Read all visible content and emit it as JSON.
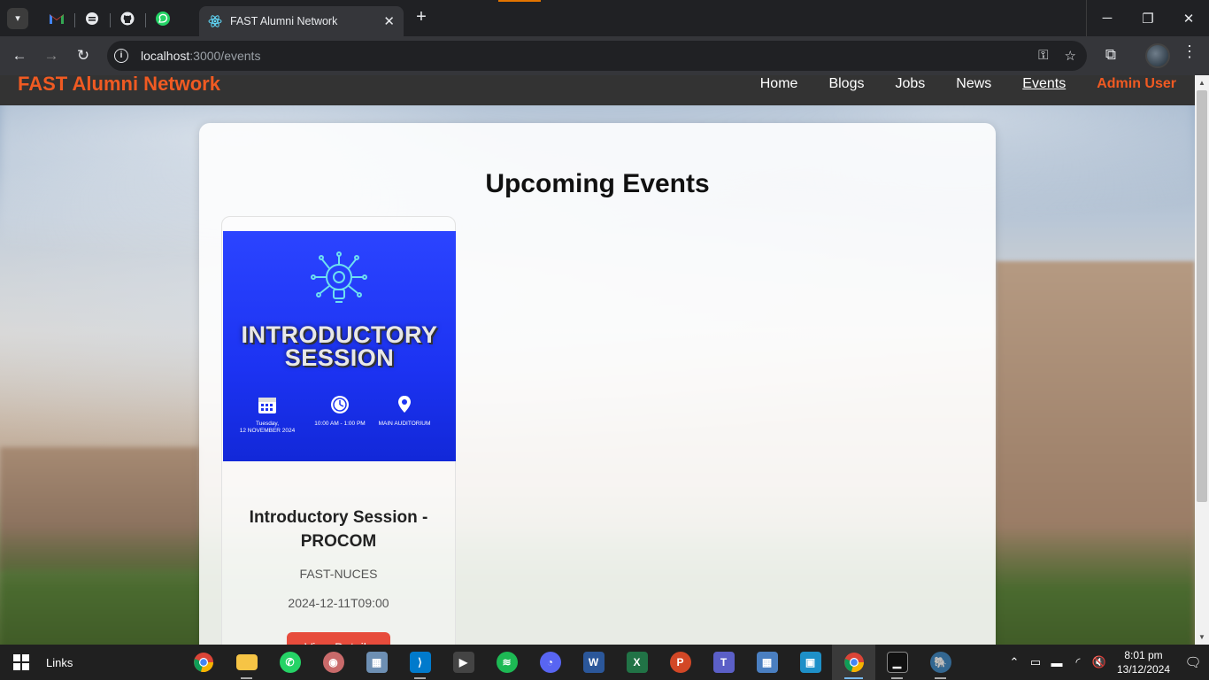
{
  "browser": {
    "active_tab_title": "FAST Alumni Network",
    "url_host": "localhost",
    "url_path": ":3000/events"
  },
  "navbar": {
    "brand": "FAST Alumni Network",
    "links": [
      "Home",
      "Blogs",
      "Jobs",
      "News",
      "Events"
    ],
    "admin": "Admin User"
  },
  "main": {
    "heading": "Upcoming Events",
    "events": [
      {
        "poster": {
          "title_line1": "INTRODUCTORY",
          "title_line2": "SESSION",
          "date_line1": "Tuesday,",
          "date_line2": "12 NOVEMBER 2024",
          "time": "10:00 AM - 1:00 PM",
          "venue": "MAIN AUDITORIUM"
        },
        "title": "Introductory Session - PROCOM",
        "organizer": "FAST-NUCES",
        "datetime": "2024-12-11T09:00",
        "button": "View Details"
      }
    ]
  },
  "taskbar": {
    "links_label": "Links",
    "time": "8:01 pm",
    "date": "13/12/2024"
  },
  "colors": {
    "brand": "#f05a22",
    "navbar_bg": "#333333",
    "button": "#e74c3c",
    "poster_blue": "#1c33f2"
  }
}
